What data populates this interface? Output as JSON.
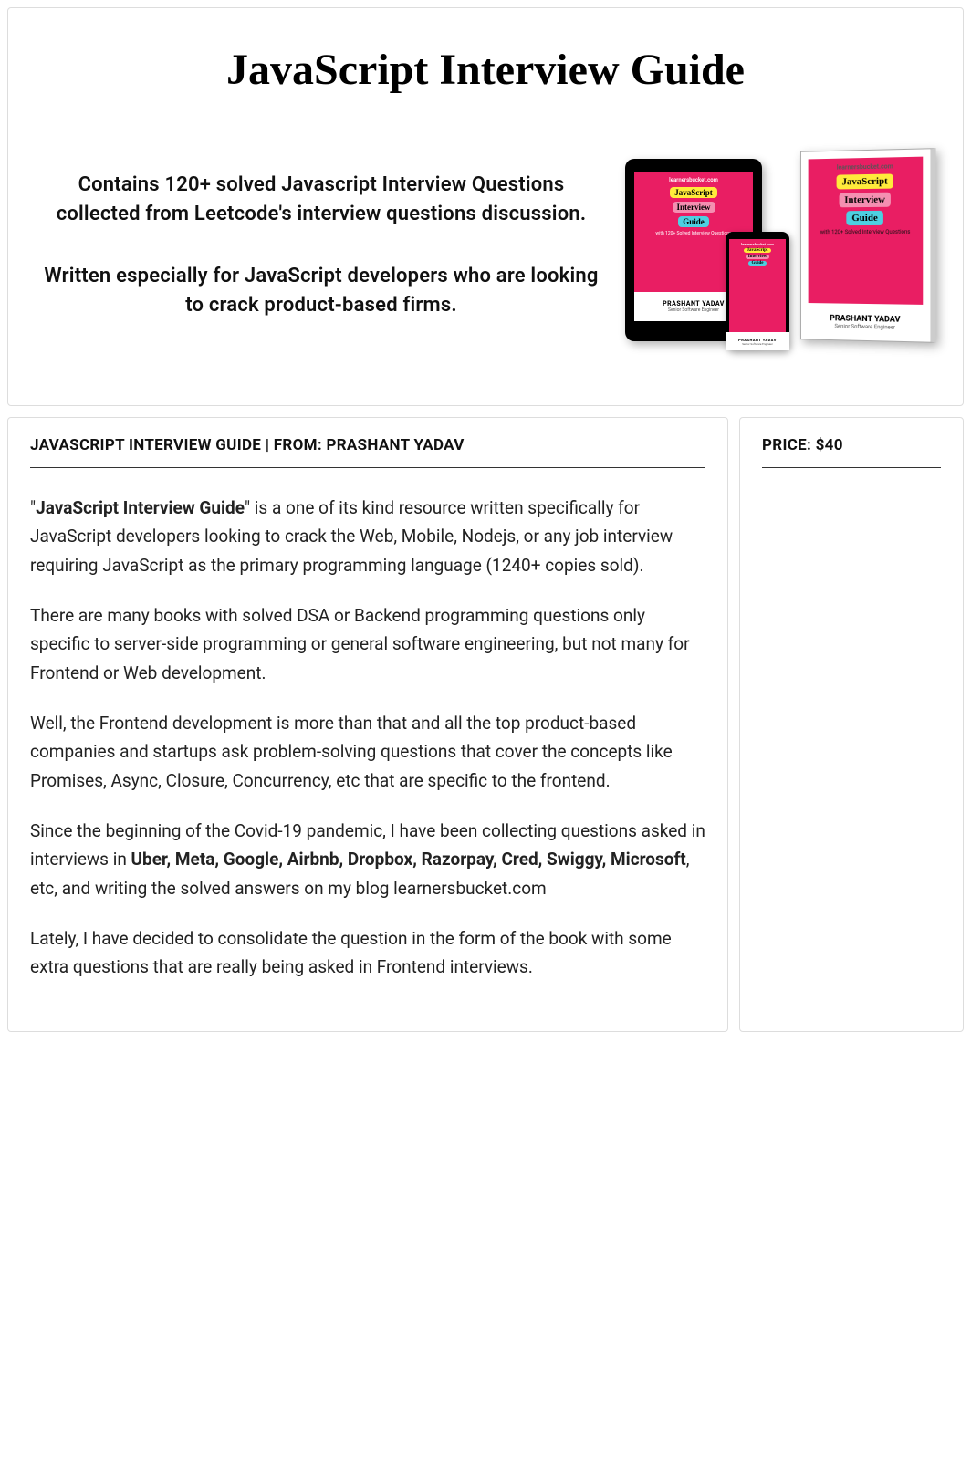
{
  "hero": {
    "title": "JavaScript Interview Guide",
    "line1": "Contains 120+ solved Javascript Interview Questions collected from Leetcode's interview questions discussion.",
    "line2": "Written especially for JavaScript developers who are looking to crack product-based firms."
  },
  "mockup": {
    "brand": "learnersbucket.com",
    "word1": "JavaScript",
    "word2": "Interview",
    "word3": "Guide",
    "subtitle": "with 120+ Solved Interview Questions",
    "author": "PRASHANT YADAV",
    "role": "Senior Software Engineer"
  },
  "main": {
    "heading": "JAVASCRIPT INTERVIEW GUIDE | FROM: PRASHANT YADAV",
    "p1_quote_open": "\"",
    "p1_strong": "JavaScript Interview Guide",
    "p1_rest": "\" is a one of its kind resource written specifically for JavaScript developers looking to crack the Web, Mobile, Nodejs, or any job interview requiring JavaScript as the primary programming language (1240+ copies sold).",
    "p2": "There are many books with solved DSA or Backend programming questions only specific to server-side programming or general software engineering, but not many for Frontend or Web development.",
    "p3": "Well, the Frontend development is more than that and all the top product-based companies and startups ask problem-solving questions that cover the concepts like Promises, Async, Closure, Concurrency, etc that are specific to the frontend.",
    "p4_a": "Since the beginning of the Covid-19 pandemic, I have been collecting questions asked in interviews in ",
    "p4_strong": "Uber, Meta, Google, Airbnb, Dropbox, Razorpay, Cred, Swiggy, Microsoft",
    "p4_b": ", etc, and writing the solved answers on my blog learnersbucket.com",
    "p5": "Lately, I have decided to consolidate the question in the form of the book with some extra questions that are really being asked in Frontend interviews."
  },
  "side": {
    "price_label": "PRICE: $40"
  }
}
